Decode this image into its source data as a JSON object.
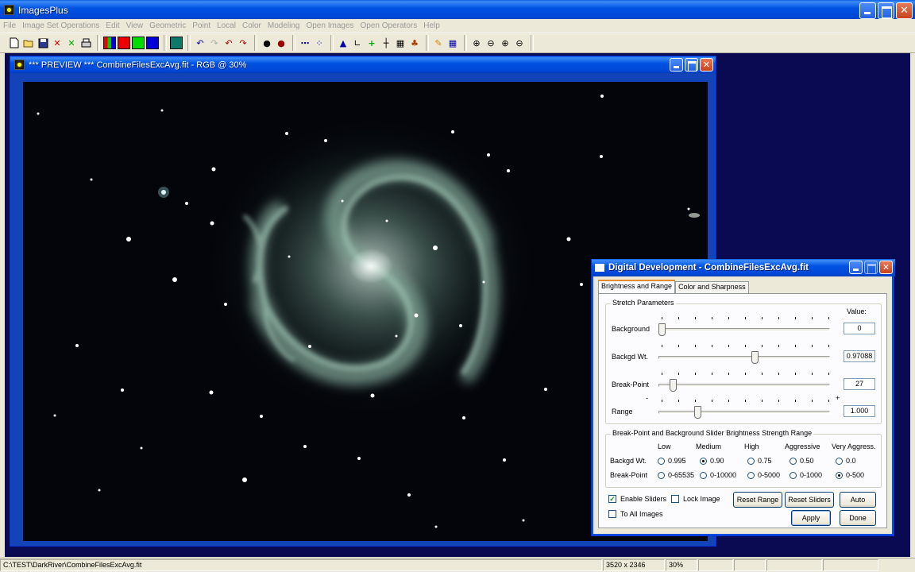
{
  "app": {
    "title": "ImagesPlus"
  },
  "menu": [
    "File",
    "Image Set Operations",
    "Edit",
    "View",
    "Geometric",
    "Point",
    "Local",
    "Color",
    "Modeling",
    "Open Images",
    "Open Operators",
    "Help"
  ],
  "image_window": {
    "title": "*** PREVIEW *** CombineFilesExcAvg.fit - RGB @ 30%"
  },
  "dialog": {
    "title": "Digital Development - CombineFilesExcAvg.fit",
    "tabs": [
      "Brightness and Range",
      "Color and Sharpness"
    ],
    "stretch": {
      "group_title": "Stretch Parameters",
      "value_header": "Value:",
      "rows": [
        {
          "label": "Background",
          "value": "0",
          "pos": 0.0
        },
        {
          "label": "Backgd Wt.",
          "value": "0.97088",
          "pos": 0.57
        },
        {
          "label": "Break-Point",
          "value": "27",
          "pos": 0.07
        },
        {
          "label": "Range",
          "value": "1.000",
          "pos": 0.22
        }
      ],
      "range_minus": "-",
      "range_plus": "+"
    },
    "strength": {
      "group_title": "Break-Point and Background Slider Brightness Strength Range",
      "columns": [
        "Low",
        "Medium",
        "High",
        "Aggressive",
        "Very Aggress."
      ],
      "backgd_label": "Backgd Wt.",
      "backgd_options": [
        "0.995",
        "0.90",
        "0.75",
        "0.50",
        "0.0"
      ],
      "backgd_selected": 1,
      "break_label": "Break-Point",
      "break_options": [
        "0-65535",
        "0-10000",
        "0-5000",
        "0-1000",
        "0-500"
      ],
      "break_selected": 4
    },
    "enable_sliders": "Enable Sliders",
    "lock_image": "Lock Image",
    "to_all_images": "To All Images",
    "buttons": {
      "reset_range": "Reset Range",
      "reset_sliders": "Reset Sliders",
      "auto": "Auto",
      "apply": "Apply",
      "done": "Done"
    }
  },
  "status": {
    "path": "C:\\TEST\\DarkRiver\\CombineFilesExcAvg.fit",
    "dimensions": "3520 x 2346",
    "zoom": "30%"
  }
}
